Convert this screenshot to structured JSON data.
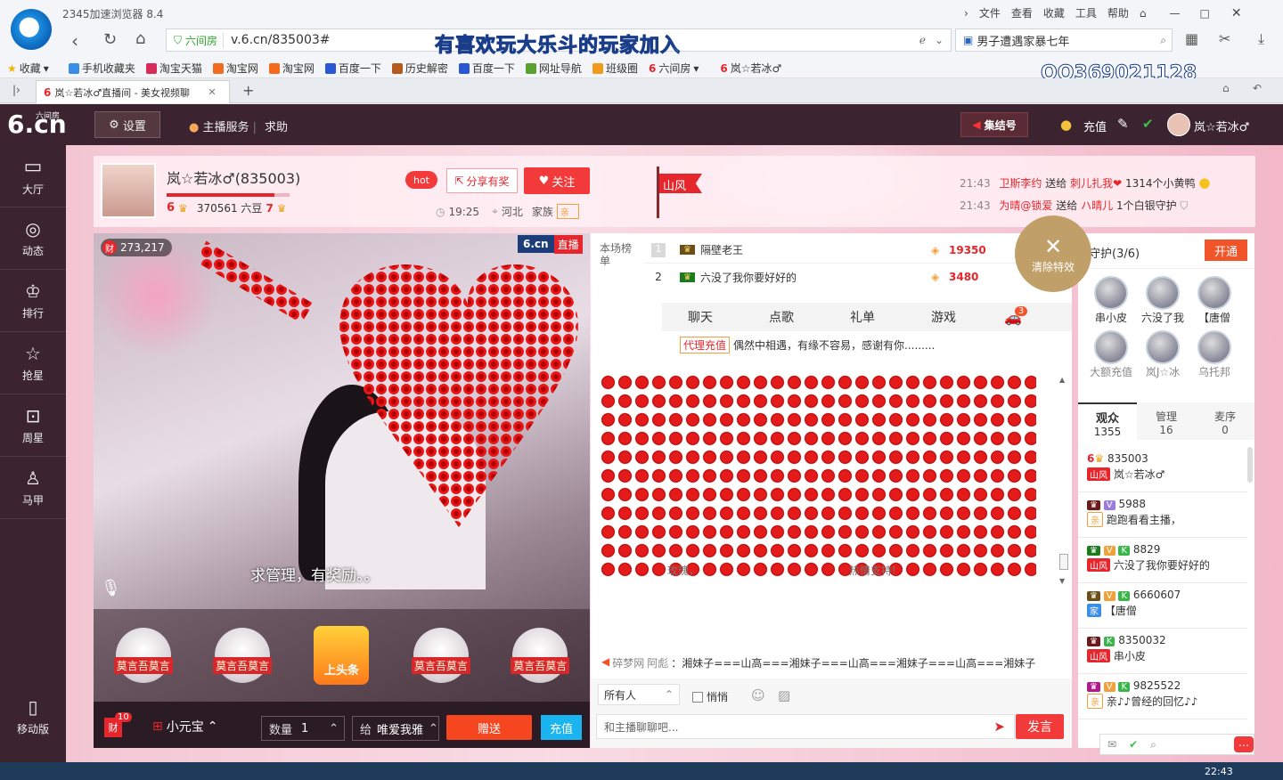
{
  "browser": {
    "title": "2345加速浏览器 8.4",
    "menu": [
      "文件",
      "查看",
      "收藏",
      "工具",
      "帮助"
    ],
    "address_badge": "六间房",
    "url": "v.6.cn/835003#",
    "search_value": "男子遭遇家暴七年",
    "overlay_title": "有喜欢玩大乐斗的玩家加入",
    "overlay_qq": "QQ369021128",
    "bookmarks": [
      "收藏",
      "手机收藏夹",
      "淘宝天猫",
      "淘宝网",
      "淘宝网",
      "百度一下",
      "历史解密",
      "百度一下",
      "网址导航",
      "班级圈",
      "六间房",
      "岚☆若冰♂"
    ],
    "tab_title": "岚☆若冰♂直播间 - 美女视频聊",
    "taskbar_time": "22:43"
  },
  "site": {
    "logo": "6.cn",
    "logo_sub": "六间房",
    "settings": "设置",
    "anchor_service": "主播服务",
    "help": "求助",
    "jijie": "集结号",
    "recharge": "充值",
    "user": "岚☆若冰♂",
    "nav": [
      "大厅",
      "动态",
      "排行",
      "抢星",
      "周星",
      "马甲",
      "移动版"
    ]
  },
  "host": {
    "name": "岚☆若冰♂(835003)",
    "level": "6",
    "beans": "370561 六豆",
    "level2": "7",
    "hot": "hot",
    "share": "分享有奖",
    "follow": "关注",
    "time": "19:25",
    "location": "河北",
    "family_label": "家族",
    "family_tag": "亲",
    "flag": "山风"
  },
  "gift_feed": [
    {
      "time": "21:43",
      "from": "卫斯李约",
      "verb": "送给",
      "to": "刺儿扎我❤",
      "gift": "1314个小黄鸭"
    },
    {
      "time": "21:43",
      "from": "为晴@锁爱",
      "verb": "送给",
      "to": "ハ晴儿",
      "gift": "1个白银守护"
    }
  ],
  "video": {
    "wealth": "273,217",
    "live_badge": "6.cn",
    "live_text": "直播",
    "banner": "求管理，有奖励。。",
    "gifts": [
      "莫言吾莫言",
      "莫言吾莫言",
      "上头条",
      "莫言吾莫言",
      "莫言吾莫言"
    ]
  },
  "gift_controls": {
    "badge": "10",
    "badge_label": "财",
    "gift_name": "小元宝",
    "qty_label": "数量",
    "qty": "1",
    "to_label": "给",
    "to_user": "唯爱我雅",
    "send": "赠送",
    "recharge": "充值"
  },
  "ranking": {
    "label": "本场榜单",
    "rows": [
      {
        "rank": "1",
        "name": "隔壁老王",
        "score": "19350"
      },
      {
        "rank": "2",
        "name": "六没了我你要好好的",
        "score": "3480"
      }
    ],
    "clear_effect": "清除特效"
  },
  "chat": {
    "tabs": [
      "聊天",
      "点歌",
      "礼单",
      "游戏"
    ],
    "car_count": "3",
    "notice_tag": "代理充值",
    "notice_text": "偶然中相遇，有缘不容易，感谢有你.........",
    "faded_text": "玫瑰，",
    "faded_text2": "热情支持!",
    "marquee_prefix": "碎梦网",
    "marquee_name": "阿彪",
    "marquee_text": "：湘妹子===山高===湘妹子===山高===湘妹子===山高===湘妹子",
    "target": "所有人",
    "whisper": "悄悄",
    "placeholder": "和主播聊聊吧...",
    "send": "发言"
  },
  "guard": {
    "title": "守护(3/6)",
    "open": "开通",
    "members": [
      "串小皮",
      "六没了我",
      "【唐僧",
      "大额充值",
      "岚J☆冰",
      "乌托邦"
    ]
  },
  "audience": {
    "tabs": [
      {
        "label": "观众",
        "count": "1355"
      },
      {
        "label": "管理",
        "count": "16"
      },
      {
        "label": "麦序",
        "count": "0"
      }
    ],
    "users": [
      {
        "id": "835003",
        "name": "岚☆若冰♂"
      },
      {
        "id": "5988",
        "name": "跑跑看看主播，"
      },
      {
        "id": "8829",
        "name": "六没了我你要好好的"
      },
      {
        "id": "6660607",
        "name": "【唐僧"
      },
      {
        "id": "8350032",
        "name": "串小皮"
      },
      {
        "id": "9825522",
        "name": "亲♪♪曾经的回忆♪♪"
      }
    ]
  },
  "colors": {
    "accent": "#f23a3a",
    "header_bg": "#3b2330",
    "pink_bg": "#f6d0dc"
  }
}
